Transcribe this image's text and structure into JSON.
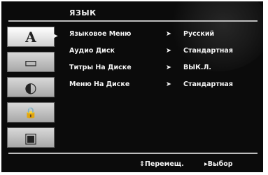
{
  "menu": {
    "title": "ЯЗЫК"
  },
  "tabs": [
    {
      "name": "language",
      "icon": "language-icon",
      "glyph": "A",
      "active": true
    },
    {
      "name": "display",
      "icon": "display-icon",
      "glyph": "▭",
      "active": false
    },
    {
      "name": "audio",
      "icon": "audio-icon",
      "glyph": "◐",
      "active": false
    },
    {
      "name": "lock",
      "icon": "lock-icon",
      "glyph": "🔒",
      "active": false
    },
    {
      "name": "others",
      "icon": "briefcase-icon",
      "glyph": "▣",
      "active": false
    }
  ],
  "items": [
    {
      "label": "Языковое Меню",
      "value": "Русский"
    },
    {
      "label": "Аудио Диск",
      "value": "Стандартная"
    },
    {
      "label": "Титры На Диске",
      "value": "ВЫК.Л."
    },
    {
      "label": "Меню На Диске",
      "value": "Стандартная"
    }
  ],
  "footer": {
    "move_hint": "⇕Перемещ.",
    "select_hint": "▸Выбор"
  }
}
